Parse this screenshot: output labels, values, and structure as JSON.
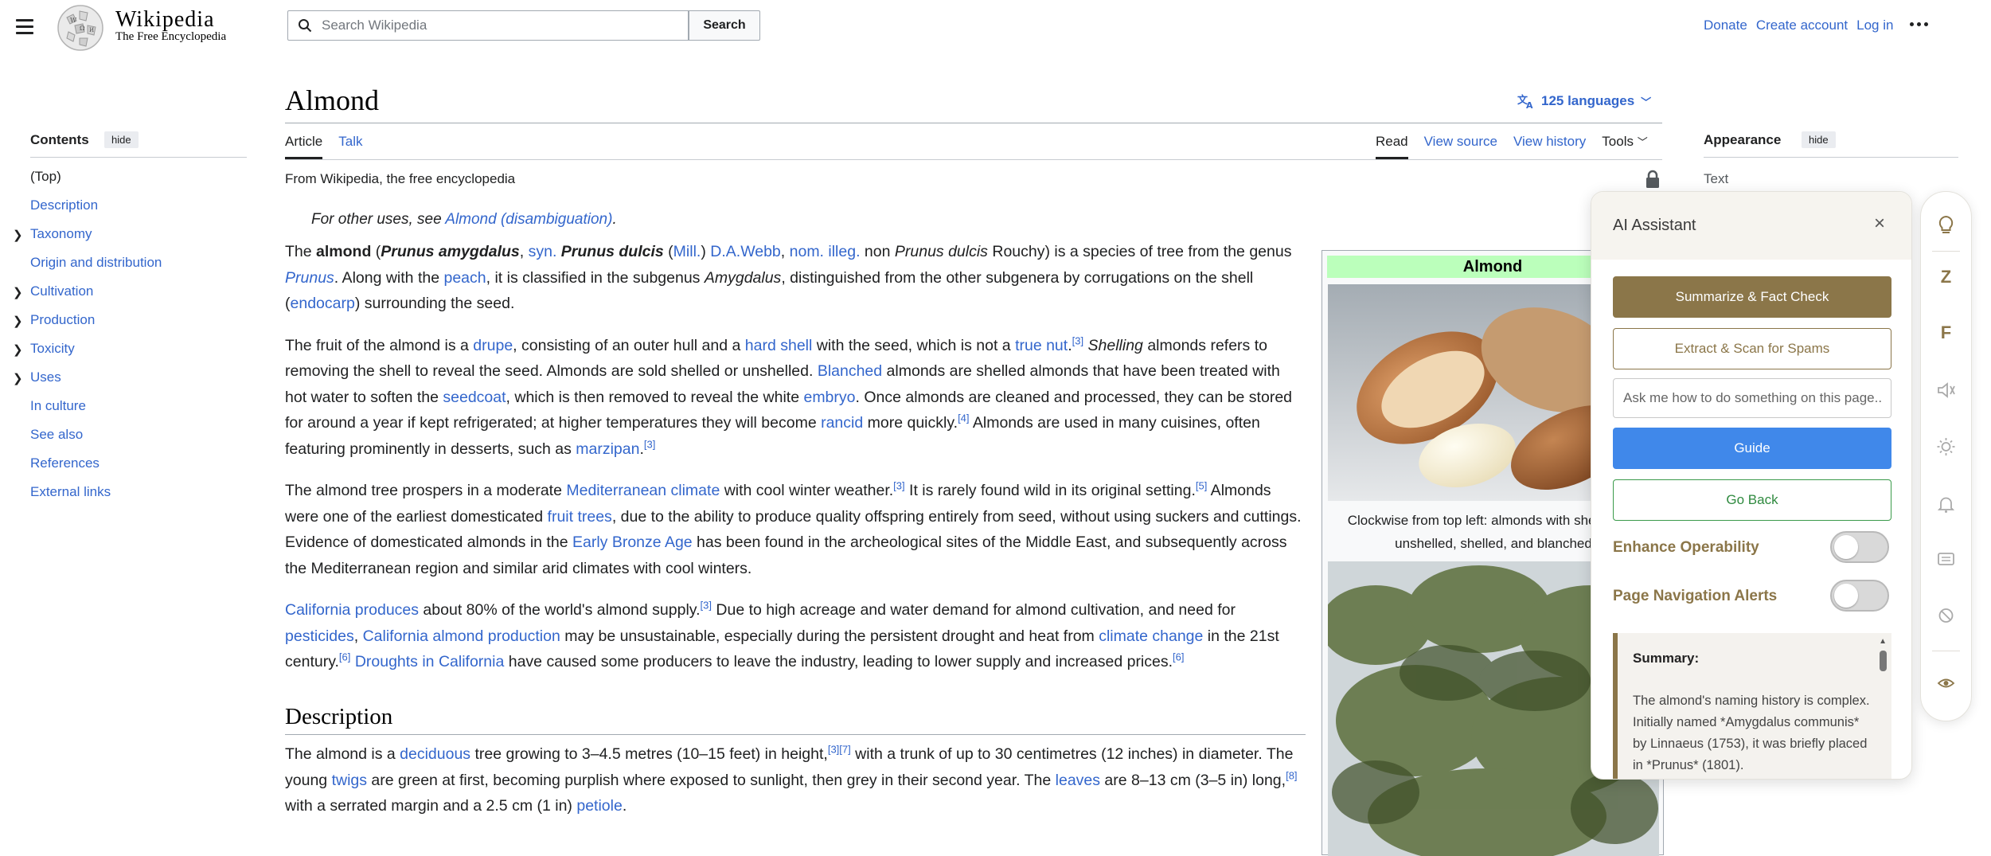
{
  "header": {
    "wordmark": "Wikipedia",
    "tagline": "The Free Encyclopedia",
    "search_placeholder": "Search Wikipedia",
    "search_button": "Search",
    "links": [
      "Donate",
      "Create account",
      "Log in"
    ]
  },
  "toc": {
    "title": "Contents",
    "hide": "hide",
    "items": [
      {
        "label": "(Top)",
        "expandable": false
      },
      {
        "label": "Description",
        "expandable": false
      },
      {
        "label": "Taxonomy",
        "expandable": true
      },
      {
        "label": "Origin and distribution",
        "expandable": false
      },
      {
        "label": "Cultivation",
        "expandable": true
      },
      {
        "label": "Production",
        "expandable": true
      },
      {
        "label": "Toxicity",
        "expandable": true
      },
      {
        "label": "Uses",
        "expandable": true
      },
      {
        "label": "In culture",
        "expandable": false
      },
      {
        "label": "See also",
        "expandable": false
      },
      {
        "label": "References",
        "expandable": false
      },
      {
        "label": "External links",
        "expandable": false
      }
    ]
  },
  "page": {
    "title": "Almond",
    "languages": "125 languages",
    "tabs_left": [
      "Article",
      "Talk"
    ],
    "tabs_right": [
      "Read",
      "View source",
      "View history",
      "Tools"
    ],
    "from": "From Wikipedia, the free encyclopedia",
    "hatnote_prefix": "For other uses, see ",
    "hatnote_link": "Almond (disambiguation)",
    "hatnote_suffix": ".",
    "description_heading": "Description"
  },
  "appearance": {
    "title": "Appearance",
    "hide": "hide",
    "text_label": "Text"
  },
  "infobox": {
    "title": "Almond",
    "caption": "Clockwise from top left: almonds with shell open, unshelled, shelled, and blanched"
  },
  "ai_assistant": {
    "title": "AI Assistant",
    "close": "×",
    "summarize": "Summarize & Fact Check",
    "extract": "Extract & Scan for Spams",
    "input_placeholder": "Ask me how to do something on this page...",
    "guide": "Guide",
    "go_back": "Go Back",
    "toggle1": "Enhance Operability",
    "toggle2": "Page Navigation Alerts",
    "toggle1_on": false,
    "toggle2_on": false,
    "summary_title": "Summary:",
    "summary_text": "The almond's naming history is complex. Initially named *Amygdalus communis* by Linnaeus (1753), it was briefly placed in *Prunus* (1801)."
  },
  "rail": {
    "letters": [
      "Z",
      "F"
    ],
    "icons": [
      "lightbulb-icon",
      "speaker-icon",
      "sun-icon",
      "bell-icon",
      "keyboard-icon",
      "block-icon",
      "eye-icon"
    ]
  },
  "colors": {
    "link": "#3366cc",
    "ai_brown": "#8b7649",
    "guide_blue": "#4088ea",
    "back_green": "#3a9a4a",
    "infobox_header": "#bbffbb"
  }
}
